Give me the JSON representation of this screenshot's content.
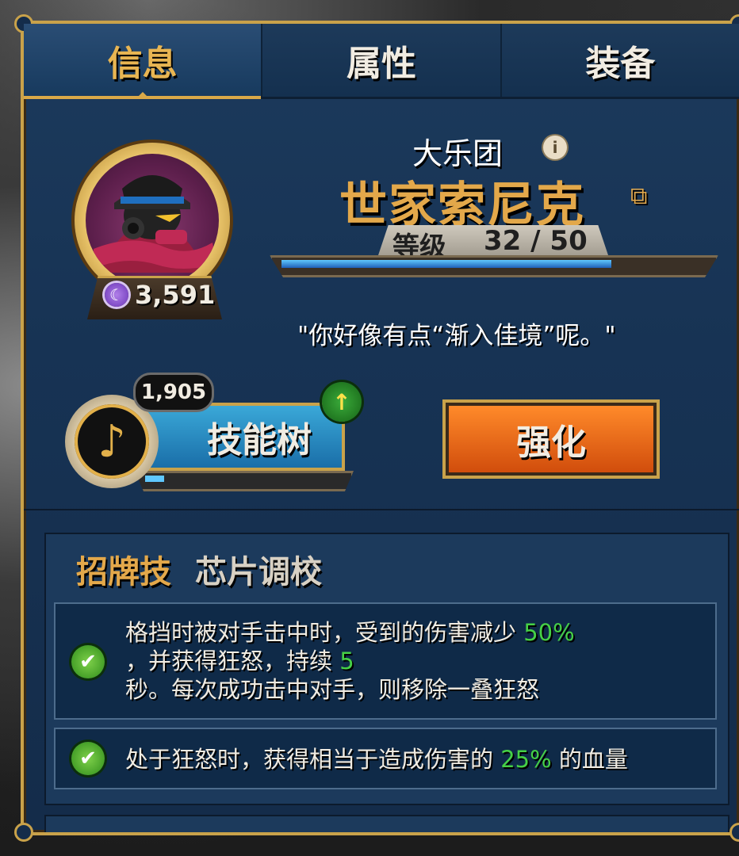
{
  "tabs": [
    {
      "label": "信息",
      "active": true
    },
    {
      "label": "属性",
      "active": false
    },
    {
      "label": "装备",
      "active": false
    }
  ],
  "hero": {
    "power": "3,591",
    "faction": "大乐团",
    "name": "世家索尼克",
    "level_label": "等级",
    "level_value": "32 / 50",
    "level_progress": 0.8,
    "quote": "\"你好像有点“渐入佳境”呢。\""
  },
  "skill_tree": {
    "label": "技能树",
    "skill_points": "1,905",
    "progress": 0.1
  },
  "enhance": {
    "label": "强化"
  },
  "signature": {
    "title": "招牌技",
    "name": "芯片调校",
    "effects": [
      {
        "lines": [
          {
            "text": "格挡时被对手击中时，受到的伤害减少 ",
            "value": "50%"
          },
          {
            "text": "，并获得狂怒，持续 ",
            "value": "5"
          },
          {
            "text": "秒。每次成功击中对手，则移除一叠狂怒",
            "value": ""
          }
        ]
      },
      {
        "lines": [
          {
            "text": "处于狂怒时，获得相当于造成伤害的 ",
            "value": "25%",
            "suffix": " 的血量"
          }
        ]
      }
    ]
  },
  "colors": {
    "accent_gold": "#e3a84a",
    "highlight_green": "#46d146",
    "panel_blue": "#1c3a5c"
  }
}
